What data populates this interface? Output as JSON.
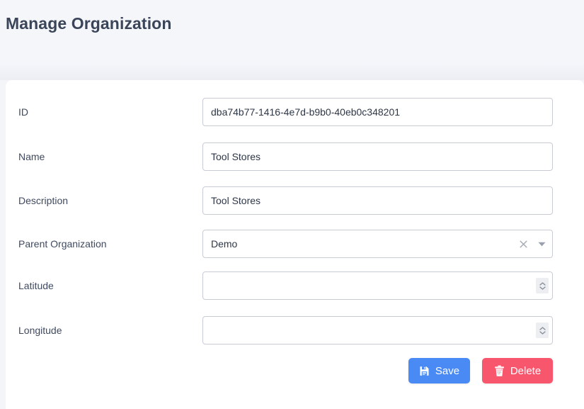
{
  "header": {
    "title": "Manage Organization"
  },
  "form": {
    "fields": [
      {
        "label": "ID",
        "type": "text",
        "value": "dba74b77-1416-4e7d-b9b0-40eb0c348201",
        "placeholder": "",
        "name": "id"
      },
      {
        "label": "Name",
        "type": "text",
        "value": "Tool Stores",
        "placeholder": "",
        "name": "name"
      },
      {
        "label": "Description",
        "type": "text",
        "value": "Tool Stores",
        "placeholder": "",
        "name": "description"
      },
      {
        "label": "Parent Organization",
        "type": "select",
        "value": "Demo",
        "placeholder": "",
        "name": "parent-organization",
        "clear_icon": "close-icon",
        "arrow_icon": "chevron-down-icon"
      },
      {
        "label": "Latitude",
        "type": "number",
        "value": "",
        "placeholder": "",
        "name": "latitude",
        "stepper_icon": "spinner-icon"
      },
      {
        "label": "Longitude",
        "type": "number",
        "value": "",
        "placeholder": "",
        "name": "longitude",
        "stepper_icon": "spinner-icon"
      }
    ]
  },
  "actions": {
    "save": {
      "label": "Save",
      "icon": "save-floppy-icon",
      "color": "#4a8af4"
    },
    "delete": {
      "label": "Delete",
      "icon": "trash-icon",
      "color": "#f8566d"
    }
  },
  "colors": {
    "page_background": "#f4f5f9",
    "card_background": "#ffffff",
    "title": "#3b4559",
    "label": "#3f4a60",
    "input_border": "#c9ccd4"
  }
}
